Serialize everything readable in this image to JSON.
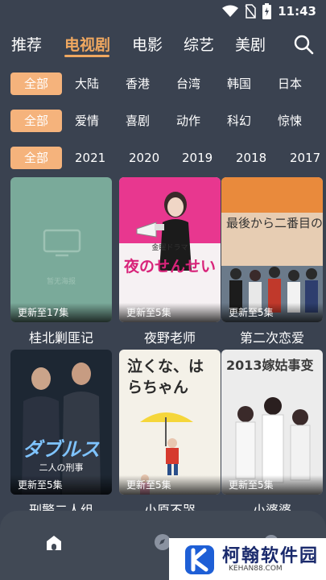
{
  "status_bar": {
    "time": "11:43"
  },
  "nav_tabs": [
    {
      "label": "推荐"
    },
    {
      "label": "电视剧"
    },
    {
      "label": "电影"
    },
    {
      "label": "综艺"
    },
    {
      "label": "美剧"
    }
  ],
  "filters": {
    "region": [
      "全部",
      "大陆",
      "香港",
      "台湾",
      "韩国",
      "日本"
    ],
    "genre": [
      "全部",
      "爱情",
      "喜剧",
      "动作",
      "科幻",
      "惊悚"
    ],
    "year": [
      "全部",
      "2021",
      "2020",
      "2019",
      "2018",
      "2017"
    ]
  },
  "cards": [
    {
      "title": "桂北剿匪记",
      "episode": "更新至17集",
      "placeholder_text": "暂无海报"
    },
    {
      "title": "夜野老师",
      "episode": "更新至5集",
      "poster_caption_small": "金曜ドラマ",
      "poster_caption": "夜のせんせい"
    },
    {
      "title": "第二次恋爱",
      "episode": "更新至5集",
      "poster_caption": "最後から二番目の"
    },
    {
      "title": "刑警二人组",
      "episode": "更新至5集",
      "poster_caption": "ダブルス",
      "poster_caption_small": "二人の刑事"
    },
    {
      "title": "小原不哭",
      "episode": "更新至5集",
      "poster_caption": "泣くな、はらちゃん"
    },
    {
      "title": "小婆婆",
      "episode": "更新至5集",
      "poster_caption": "2013嫁姑事变"
    }
  ],
  "watermark": {
    "name": "柯翰软件园",
    "url": "KEHAN88.COM"
  }
}
